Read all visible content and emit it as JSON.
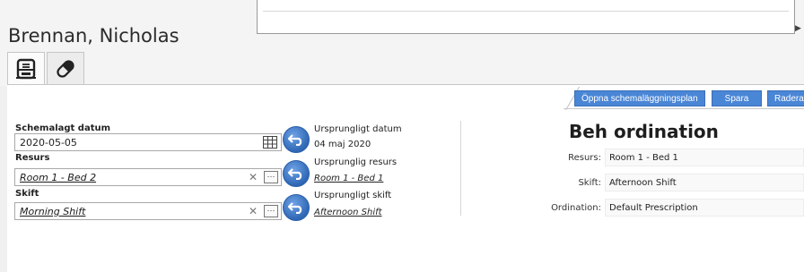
{
  "header": {
    "patient_name": "Brennan, Nicholas",
    "tabs": [
      {
        "icon": "schedule-planner-icon"
      },
      {
        "icon": "pill-icon"
      }
    ]
  },
  "toolbar": {
    "open_plan_label": "Öppna schemaläggningsplan",
    "save_label": "Spara",
    "delete_label": "Radera"
  },
  "form": {
    "scheduled_date": {
      "label": "Schemalagt datum",
      "value": "2020-05-05"
    },
    "resource": {
      "label": "Resurs",
      "value": "Room 1 - Bed 2"
    },
    "shift": {
      "label": "Skift",
      "value": "Morning Shift"
    },
    "original_date": {
      "label": "Ursprungligt datum",
      "value": "04 maj 2020"
    },
    "original_resource": {
      "label": "Ursprunglig resurs",
      "value": "Room 1 - Bed 1"
    },
    "original_shift": {
      "label": "Ursprungligt skift",
      "value": "Afternoon Shift"
    }
  },
  "details": {
    "title": "Beh ordination",
    "resource_label": "Resurs:",
    "resource_value": "Room 1 - Bed 1",
    "shift_label": "Skift:",
    "shift_value": "Afternoon Shift",
    "prescription_label": "Ordination:",
    "prescription_value": "Default Prescription"
  },
  "colors": {
    "button_blue": "#4a86d6",
    "revert_blue": "#2f67b5"
  }
}
